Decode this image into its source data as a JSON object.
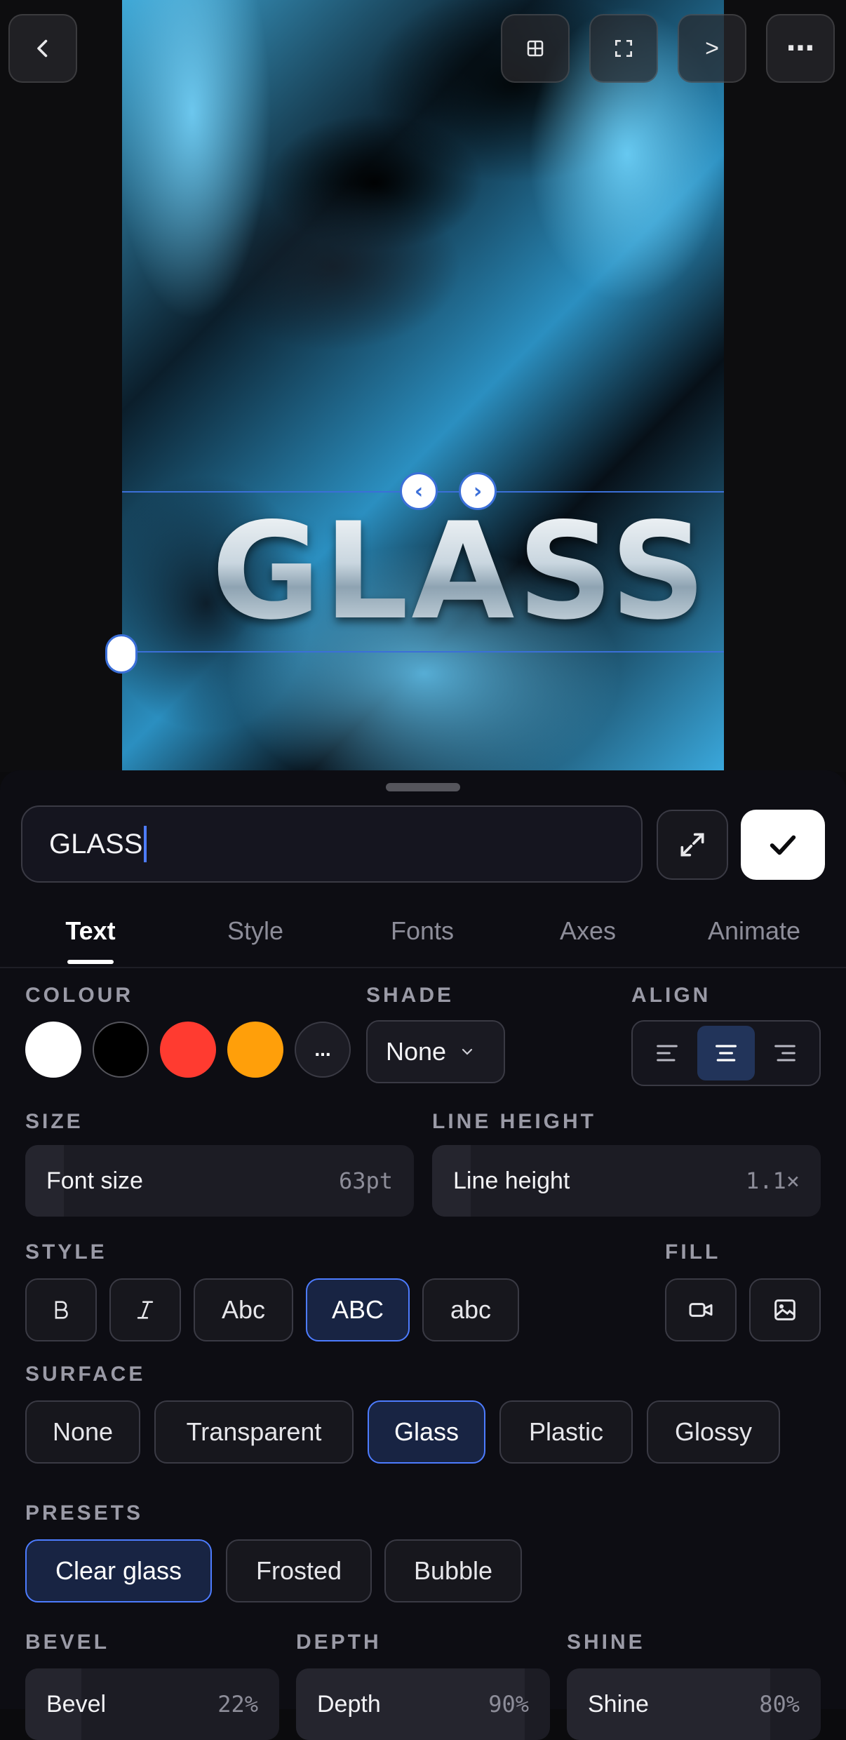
{
  "canvas": {
    "headline": "GLASS"
  },
  "toolbar": {
    "back_icon": "chevron-left-icon",
    "grid_icon": "grid-icon",
    "frame_icon": "frame-icon",
    "next_label": ">",
    "more_label": "⋯"
  },
  "editor": {
    "input_value": "GLASS",
    "expand_icon": "expand-arrows-icon",
    "confirm_icon": "checkmark-icon"
  },
  "tabs": [
    "Text",
    "Style",
    "Fonts",
    "Axes",
    "Animate"
  ],
  "active_tab": "Text",
  "colour": {
    "label": "COLOUR",
    "swatches": [
      "#ffffff",
      "#000000",
      "#ff3b30",
      "#ff9f0a"
    ],
    "more_label": "..."
  },
  "shade": {
    "label": "SHADE",
    "value": "None"
  },
  "align": {
    "label": "ALIGN",
    "selected": "center"
  },
  "size": {
    "label": "SIZE",
    "name": "Font size",
    "value": "63pt",
    "fraction": 0.1
  },
  "line_height": {
    "label": "LINE HEIGHT",
    "name": "Line height",
    "value": "1.1×",
    "fraction": 0.1
  },
  "style": {
    "label": "STYLE",
    "options": [
      "B",
      "I",
      "Abc",
      "ABC",
      "abc"
    ],
    "selected": "ABC"
  },
  "fill": {
    "label": "FILL",
    "video_icon": "video-icon",
    "image_icon": "image-icon"
  },
  "surface": {
    "label": "SURFACE",
    "options": [
      "None",
      "Transparent",
      "Glass",
      "Plastic",
      "Glossy"
    ],
    "selected": "Glass"
  },
  "presets": {
    "label": "PRESETS",
    "options": [
      "Clear glass",
      "Frosted",
      "Bubble"
    ],
    "selected": "Clear glass"
  },
  "bevel": {
    "label": "BEVEL",
    "name": "Bevel",
    "value": "22%",
    "fraction": 0.22
  },
  "depth": {
    "label": "DEPTH",
    "name": "Depth",
    "value": "90%",
    "fraction": 0.9
  },
  "shine": {
    "label": "SHINE",
    "name": "Shine",
    "value": "80%",
    "fraction": 0.8
  },
  "colors": {
    "accent": "#4d7cff",
    "selection": "#3b6fd8"
  }
}
